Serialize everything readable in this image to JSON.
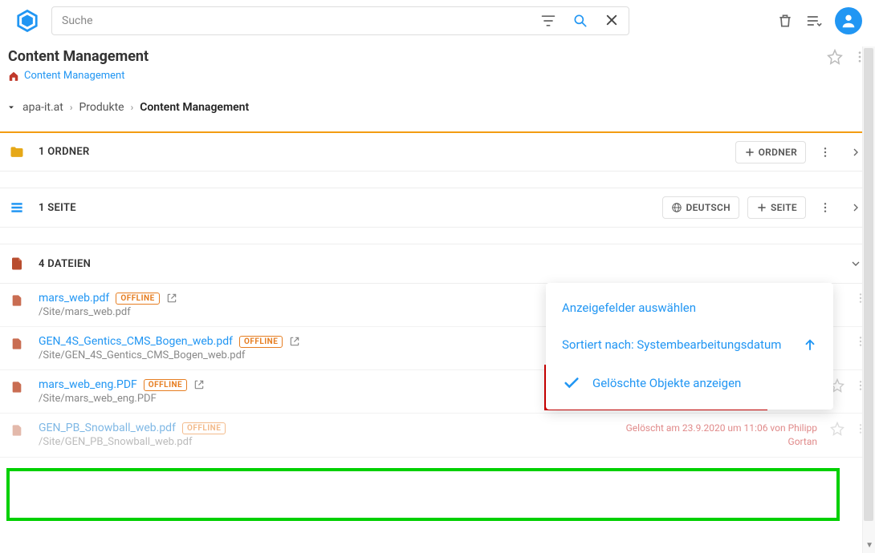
{
  "search": {
    "placeholder": "Suche"
  },
  "pageTitle": "Content Management",
  "breadcrumbLink": "Content Management",
  "navCrumbs": [
    "apa-it.at",
    "Produkte",
    "Content Management"
  ],
  "sections": {
    "folders": {
      "label": "1 ORDNER",
      "addBtn": "ORDNER"
    },
    "pages": {
      "label": "1 SEITE",
      "langBtn": "DEUTSCH",
      "addBtn": "SEITE"
    },
    "files": {
      "label": "4 DATEIEN"
    }
  },
  "files": [
    {
      "name": "mars_web.pdf",
      "path": "/Site/mars_web.pdf",
      "offline": "OFFLINE",
      "deleted": false
    },
    {
      "name": "GEN_4S_Gentics_CMS_Bogen_web.pdf",
      "path": "/Site/GEN_4S_Gentics_CMS_Bogen_web.pdf",
      "offline": "OFFLINE",
      "deleted": false
    },
    {
      "name": "mars_web_eng.PDF",
      "path": "/Site/mars_web_eng.PDF",
      "offline": "OFFLINE",
      "deleted": false
    },
    {
      "name": "GEN_PB_Snowball_web.pdf",
      "path": "/Site/GEN_PB_Snowball_web.pdf",
      "offline": "OFFLINE",
      "deleted": true,
      "deletedInfo": "Gelöscht am 23.9.2020 um 11:06 von Philipp Gortan"
    }
  ],
  "dropdown": {
    "selectFields": "Anzeigefelder auswählen",
    "sortBy": "Sortiert nach: Systembearbeitungsdatum",
    "showDeleted": "Gelöschte Objekte anzeigen"
  }
}
